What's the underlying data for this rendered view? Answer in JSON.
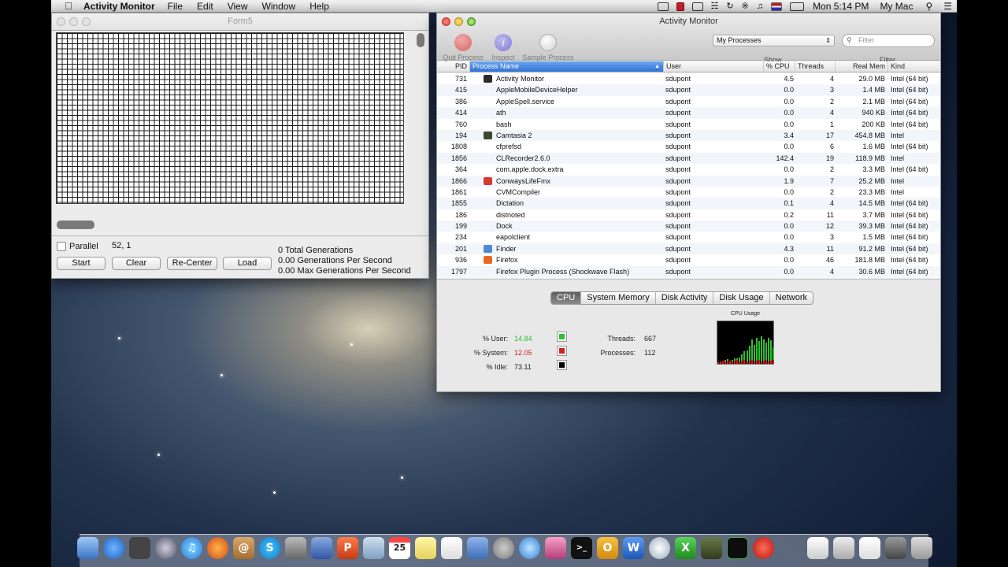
{
  "menubar": {
    "app_name": "Activity Monitor",
    "items": [
      "File",
      "Edit",
      "View",
      "Window",
      "Help"
    ],
    "clock": "Mon 5:14 PM",
    "user": "My Mac"
  },
  "form5": {
    "title": "Form5",
    "parallel_label": "Parallel",
    "coords": "52, 1",
    "buttons": {
      "start": "Start",
      "clear": "Clear",
      "recenter": "Re-Center",
      "load": "Load"
    },
    "stats": [
      "0 Total Generations",
      "0.00 Generations Per Second",
      "0.00 Max Generations Per Second"
    ]
  },
  "activity_monitor": {
    "title": "Activity Monitor",
    "toolbar": {
      "quit": "Quit Process",
      "inspect": "Inspect",
      "sample": "Sample Process",
      "show_label": "Show",
      "filter_label": "Filter"
    },
    "show_value": "My Processes",
    "filter_placeholder": "Filter",
    "columns": [
      "PID",
      "Process Name",
      "User",
      "% CPU",
      "Threads",
      "Real Mem",
      "Kind"
    ],
    "rows": [
      {
        "pid": "731",
        "name": "Activity Monitor",
        "user": "sdupont",
        "cpu": "4.5",
        "threads": "4",
        "mem": "29.0 MB",
        "kind": "Intel (64 bit)",
        "icon": "#2b2b2b"
      },
      {
        "pid": "415",
        "name": "AppleMobileDeviceHelper",
        "user": "sdupont",
        "cpu": "0.0",
        "threads": "3",
        "mem": "1.4 MB",
        "kind": "Intel (64 bit)",
        "icon": ""
      },
      {
        "pid": "386",
        "name": "AppleSpell.service",
        "user": "sdupont",
        "cpu": "0.0",
        "threads": "2",
        "mem": "2.1 MB",
        "kind": "Intel (64 bit)",
        "icon": ""
      },
      {
        "pid": "414",
        "name": "ath",
        "user": "sdupont",
        "cpu": "0.0",
        "threads": "4",
        "mem": "940 KB",
        "kind": "Intel (64 bit)",
        "icon": ""
      },
      {
        "pid": "760",
        "name": "bash",
        "user": "sdupont",
        "cpu": "0.0",
        "threads": "1",
        "mem": "200 KB",
        "kind": "Intel (64 bit)",
        "icon": ""
      },
      {
        "pid": "194",
        "name": "Camtasia 2",
        "user": "sdupont",
        "cpu": "3.4",
        "threads": "17",
        "mem": "454.8 MB",
        "kind": "Intel",
        "icon": "#3d4a2a"
      },
      {
        "pid": "1808",
        "name": "cfprefsd",
        "user": "sdupont",
        "cpu": "0.0",
        "threads": "6",
        "mem": "1.6 MB",
        "kind": "Intel (64 bit)",
        "icon": ""
      },
      {
        "pid": "1856",
        "name": "CLRecorder2.6.0",
        "user": "sdupont",
        "cpu": "142.4",
        "threads": "19",
        "mem": "118.9 MB",
        "kind": "Intel",
        "icon": ""
      },
      {
        "pid": "364",
        "name": "com.apple.dock.extra",
        "user": "sdupont",
        "cpu": "0.0",
        "threads": "2",
        "mem": "3.3 MB",
        "kind": "Intel (64 bit)",
        "icon": ""
      },
      {
        "pid": "1866",
        "name": "ConwaysLifeFmx",
        "user": "sdupont",
        "cpu": "1.9",
        "threads": "7",
        "mem": "25.2 MB",
        "kind": "Intel",
        "icon": "#d63a2f"
      },
      {
        "pid": "1861",
        "name": "CVMCompiler",
        "user": "sdupont",
        "cpu": "0.0",
        "threads": "2",
        "mem": "23.3 MB",
        "kind": "Intel",
        "icon": ""
      },
      {
        "pid": "1855",
        "name": "Dictation",
        "user": "sdupont",
        "cpu": "0.1",
        "threads": "4",
        "mem": "14.5 MB",
        "kind": "Intel (64 bit)",
        "icon": ""
      },
      {
        "pid": "186",
        "name": "distnoted",
        "user": "sdupont",
        "cpu": "0.2",
        "threads": "11",
        "mem": "3.7 MB",
        "kind": "Intel (64 bit)",
        "icon": ""
      },
      {
        "pid": "199",
        "name": "Dock",
        "user": "sdupont",
        "cpu": "0.0",
        "threads": "12",
        "mem": "39.3 MB",
        "kind": "Intel (64 bit)",
        "icon": ""
      },
      {
        "pid": "234",
        "name": "eapolclient",
        "user": "sdupont",
        "cpu": "0.0",
        "threads": "3",
        "mem": "1.5 MB",
        "kind": "Intel (64 bit)",
        "icon": ""
      },
      {
        "pid": "201",
        "name": "Finder",
        "user": "sdupont",
        "cpu": "4.3",
        "threads": "11",
        "mem": "91.2 MB",
        "kind": "Intel (64 bit)",
        "icon": "#4a8ad8"
      },
      {
        "pid": "936",
        "name": "Firefox",
        "user": "sdupont",
        "cpu": "0.0",
        "threads": "46",
        "mem": "181.8 MB",
        "kind": "Intel (64 bit)",
        "icon": "#e56a1f"
      },
      {
        "pid": "1797",
        "name": "Firefox Plugin Process (Shockwave Flash)",
        "user": "sdupont",
        "cpu": "0.0",
        "threads": "4",
        "mem": "30.6 MB",
        "kind": "Intel (64 bit)",
        "icon": ""
      }
    ],
    "tabs": [
      "CPU",
      "System Memory",
      "Disk Activity",
      "Disk Usage",
      "Network"
    ],
    "cpu": {
      "user_label": "% User:",
      "user_value": "14.84",
      "user_color": "#2fbf2f",
      "system_label": "% System:",
      "system_value": "12.05",
      "system_color": "#d42020",
      "idle_label": "% Idle:",
      "idle_value": "73.11",
      "idle_color": "#000000",
      "threads_label": "Threads:",
      "threads_value": "667",
      "processes_label": "Processes:",
      "processes_value": "112",
      "chart_title": "CPU Usage"
    }
  }
}
